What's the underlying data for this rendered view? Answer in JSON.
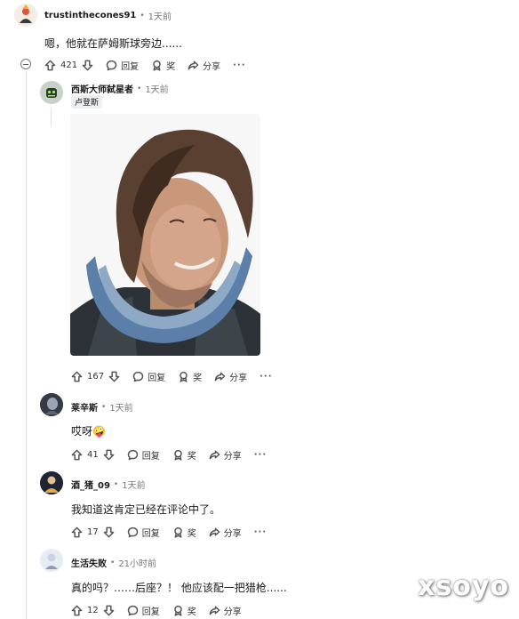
{
  "comments": [
    {
      "username": "trustinthecones91",
      "time": "1天前",
      "text": "嗯，他就在萨姆斯球旁边......",
      "votes": "421",
      "reply_label": "回复",
      "award_label": "奖",
      "share_label": "分享"
    },
    {
      "username": "西斯大师弑星者",
      "time": "1天前",
      "flair": "卢登斯",
      "votes": "167",
      "reply_label": "回复",
      "award_label": "奖",
      "share_label": "分享"
    },
    {
      "username": "莱辛斯",
      "time": "1天前",
      "text": "哎呀🤪",
      "votes": "41",
      "reply_label": "回复",
      "award_label": "奖",
      "share_label": "分享"
    },
    {
      "username": "酒_猪_09",
      "time": "1天前",
      "text": "我知道这肯定已经在评论中了。",
      "votes": "17",
      "reply_label": "回复",
      "award_label": "奖",
      "share_label": "分享"
    },
    {
      "username": "生活失败",
      "time": "21小时前",
      "text": "真的吗？……后座？！ 他应该配一把猎枪......",
      "votes": "12",
      "reply_label": "回复",
      "award_label": "奖",
      "share_label": "分享"
    }
  ],
  "separator": "•",
  "more_label": "···",
  "watermark": "xsoyo",
  "colors": {
    "text": "#1a1a1b",
    "meta": "#777777",
    "thread_line": "#e0e0e0",
    "flair_bg": "#edeff1"
  }
}
